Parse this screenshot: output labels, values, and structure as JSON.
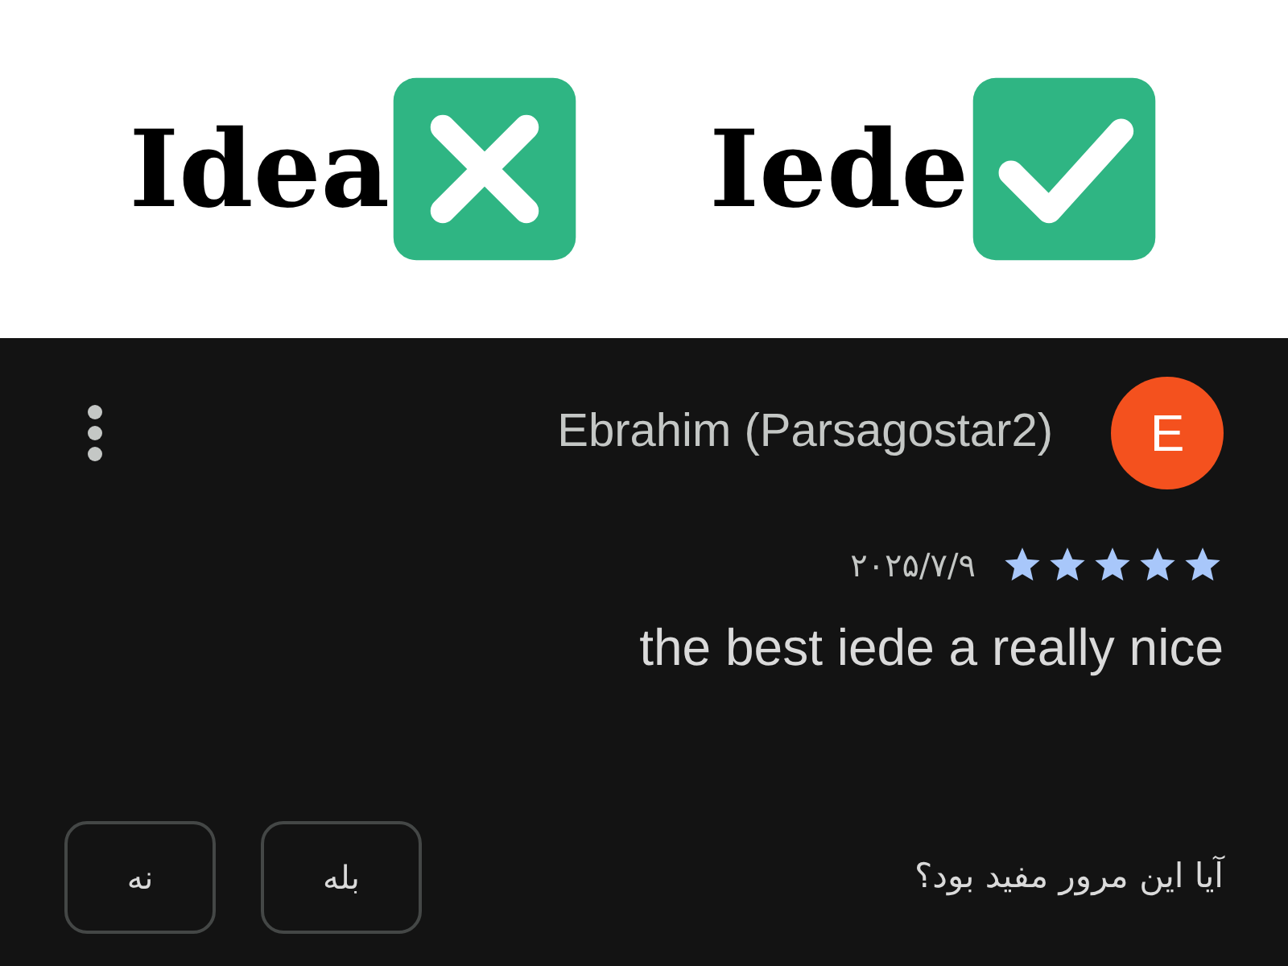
{
  "wrong_example": {
    "text": "Idea",
    "kind": "wrong"
  },
  "right_example": {
    "text": "Iede",
    "kind": "right"
  },
  "review": {
    "author": "Ebrahim (Parsagostar2)",
    "avatar_letter": "E",
    "stars": 5,
    "date": "۲۰۲۵/۷/۹",
    "text": "the best iede a really nice",
    "helpful_question": "آیا این مرور مفید بود؟",
    "buttons": [
      "بله",
      "نه"
    ]
  }
}
